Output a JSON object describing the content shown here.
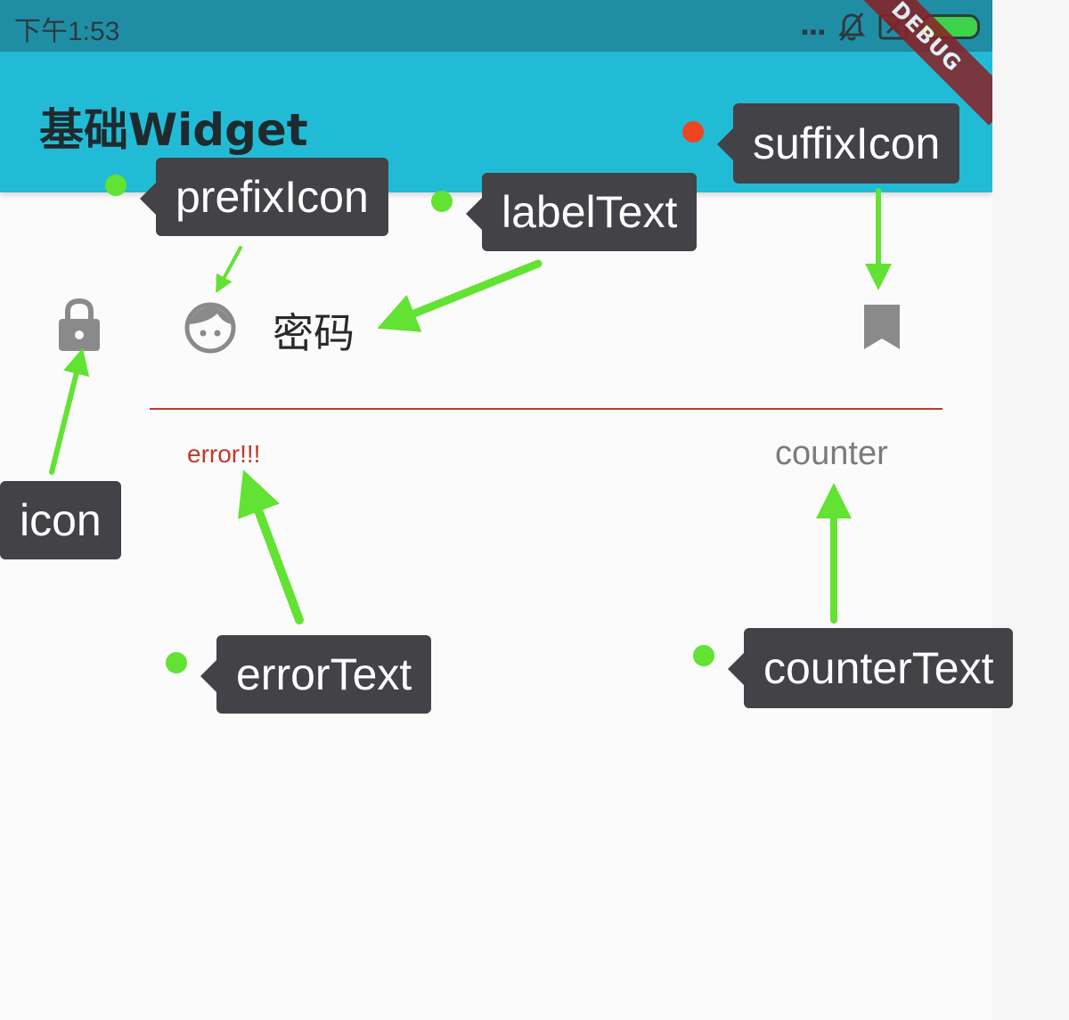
{
  "status_bar": {
    "time": "下午1:53",
    "dots": "..."
  },
  "app_bar": {
    "title": "基础Widget",
    "debug_banner": "DEBUG"
  },
  "form": {
    "label_text": "密码",
    "error_text": "error!!!",
    "counter_text": "counter"
  },
  "annotations": {
    "prefix_icon": "prefixIcon",
    "label_text": "labelText",
    "suffix_icon": "suffixIcon",
    "icon": "icon",
    "error_text": "errorText",
    "counter_text": "counterText"
  },
  "colors": {
    "app_bar": "#22bbd6",
    "status_bar": "#1f8ea4",
    "error": "#c0392b",
    "annotation_arrow": "#62e232",
    "callout_bg": "#434246"
  }
}
